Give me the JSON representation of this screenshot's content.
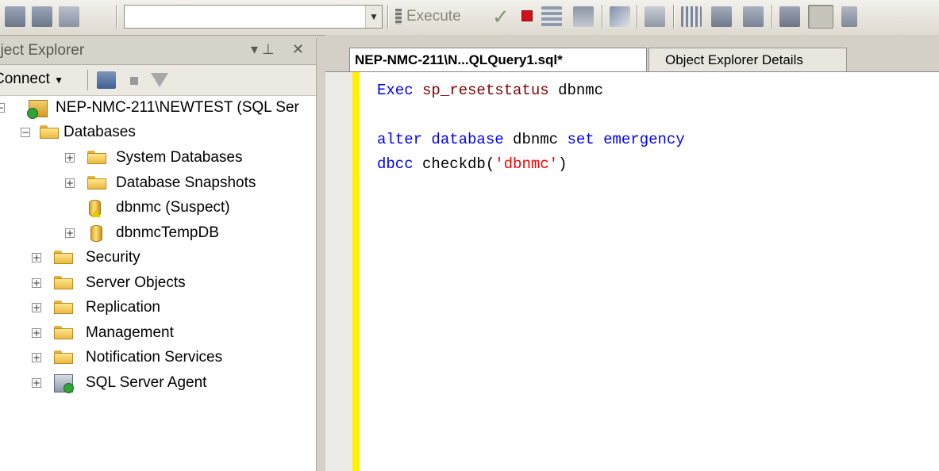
{
  "toolbar": {
    "database_combo_value": "",
    "execute_label": "Execute",
    "icons": [
      "toolbar-icon",
      "parse-check-icon",
      "cancel-stop-icon",
      "results-grid-icon"
    ]
  },
  "object_explorer": {
    "title": "bject Explorer",
    "pin": "▾ ⊥",
    "close": "✕",
    "connect_label": "Connect",
    "tree": [
      {
        "label": "NEP-NMC-211\\NEWTEST (SQL Ser",
        "icon": "server-icon"
      },
      {
        "label": "Databases",
        "icon": "folder-icon"
      },
      {
        "label": "System Databases",
        "icon": "folder-icon"
      },
      {
        "label": "Database Snapshots",
        "icon": "folder-icon"
      },
      {
        "label": "dbnmc (Suspect)",
        "icon": "database-warning-icon"
      },
      {
        "label": "dbnmcTempDB",
        "icon": "database-icon"
      },
      {
        "label": "Security",
        "icon": "folder-icon"
      },
      {
        "label": "Server Objects",
        "icon": "folder-icon"
      },
      {
        "label": "Replication",
        "icon": "folder-icon"
      },
      {
        "label": "Management",
        "icon": "folder-icon"
      },
      {
        "label": "Notification Services",
        "icon": "folder-icon"
      },
      {
        "label": "SQL Server Agent",
        "icon": "agent-icon"
      }
    ]
  },
  "editor": {
    "tabs": [
      {
        "label": "NEP-NMC-211\\N...QLQuery1.sql*",
        "active": true
      },
      {
        "label": "Object Explorer Details",
        "active": false
      }
    ],
    "code": {
      "line1": {
        "kw": "Exec",
        "proc": "sp_resetstatus",
        "rest": "dbnmc"
      },
      "line3": {
        "kw1": "alter",
        "kw2": "database",
        "name": "dbnmc",
        "kw3": "set",
        "kw4": "emergency"
      },
      "line4": {
        "kw": "dbcc",
        "fn": "checkdb(",
        "str": "'dbnmc'",
        "close": ")"
      }
    }
  }
}
